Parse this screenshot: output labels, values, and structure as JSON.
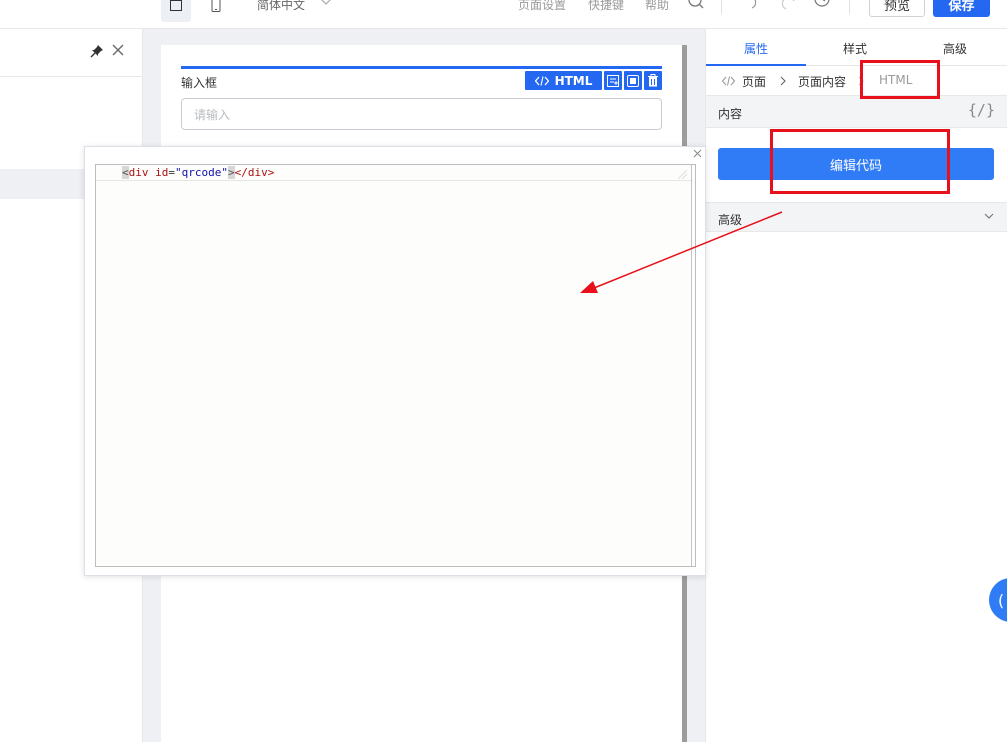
{
  "topbar": {
    "language": "简体中文",
    "page_settings": "页面设置",
    "shortcuts": "快捷键",
    "help": "帮助",
    "preview": "预览",
    "save": "保存"
  },
  "canvas": {
    "field_label": "输入框",
    "html_tool_label": "HTML",
    "input_placeholder": "请输入"
  },
  "right_panel": {
    "tabs": [
      "属性",
      "样式",
      "高级"
    ],
    "active_tab": "属性",
    "breadcrumb": [
      "页面",
      "页面内容",
      "HTML"
    ],
    "content_section": "内容",
    "formula_icon_text": "{/}",
    "edit_code_button": "编辑代码",
    "advanced_section": "高级"
  },
  "code_editor": {
    "lines": [
      "<div id=\"qrcode\"></div>"
    ],
    "tokens": {
      "open_lt": "<",
      "tag_name": "div",
      "space": " ",
      "attr_name": "id",
      "eq": "=",
      "attr_value": "\"qrcode\"",
      "open_gt": ">",
      "close_tag": "</div>"
    }
  },
  "colors": {
    "primary": "#2468f2",
    "annotation_red": "#e8101a"
  }
}
